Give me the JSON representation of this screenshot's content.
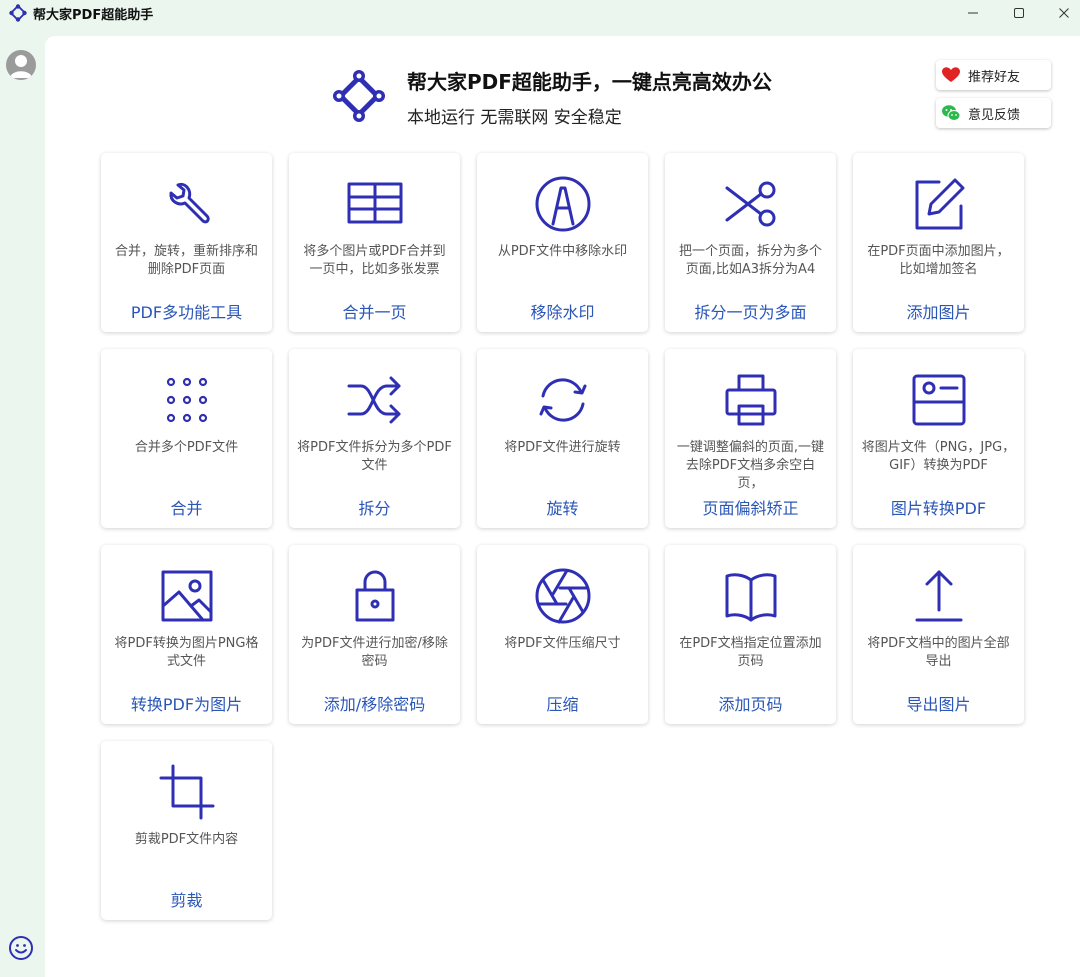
{
  "window": {
    "title": "帮大家PDF超能助手",
    "controls": [
      "minimize",
      "maximize",
      "close"
    ]
  },
  "header": {
    "title": "帮大家PDF超能助手，一键点亮高效办公",
    "subtitle": "本地运行 无需联网 安全稳定",
    "recommend_label": "推荐好友",
    "feedback_label": "意见反馈"
  },
  "colors": {
    "accent": "#2f2fb4",
    "label": "#2a56b8",
    "sidebar_bg": "#eaf6ee",
    "recommend": "#e02424",
    "feedback": "#2db84d"
  },
  "tools": [
    {
      "icon": "wrench-icon",
      "desc": "合并，旋转，重新排序和删除PDF页面",
      "label": "PDF多功能工具"
    },
    {
      "icon": "table-grid-icon",
      "desc": "将多个图片或PDF合并到一页中，比如多张发票",
      "label": "合并一页"
    },
    {
      "icon": "watermark-icon",
      "desc": "从PDF文件中移除水印",
      "label": "移除水印"
    },
    {
      "icon": "scissors-icon",
      "desc": "把一个页面，拆分为多个页面,比如A3拆分为A4",
      "label": "拆分一页为多面"
    },
    {
      "icon": "edit-icon",
      "desc": "在PDF页面中添加图片，比如增加签名",
      "label": "添加图片"
    },
    {
      "icon": "dots-grid-icon",
      "desc": "合并多个PDF文件",
      "label": "合并"
    },
    {
      "icon": "shuffle-icon",
      "desc": "将PDF文件拆分为多个PDF文件",
      "label": "拆分"
    },
    {
      "icon": "rotate-icon",
      "desc": "将PDF文件进行旋转",
      "label": "旋转"
    },
    {
      "icon": "printer-icon",
      "desc": "一键调整偏斜的页面,一键去除PDF文档多余空白页，",
      "label": "页面偏斜矫正"
    },
    {
      "icon": "id-card-icon",
      "desc": "将图片文件（PNG，JPG，GIF）转换为PDF",
      "label": "图片转换PDF"
    },
    {
      "icon": "image-icon",
      "desc": "将PDF转换为图片PNG格式文件",
      "label": "转换PDF为图片"
    },
    {
      "icon": "lock-icon",
      "desc": "为PDF文件进行加密/移除密码",
      "label": "添加/移除密码"
    },
    {
      "icon": "aperture-icon",
      "desc": "将PDF文件压缩尺寸",
      "label": "压缩"
    },
    {
      "icon": "book-icon",
      "desc": "在PDF文档指定位置添加页码",
      "label": "添加页码"
    },
    {
      "icon": "upload-icon",
      "desc": "将PDF文档中的图片全部导出",
      "label": "导出图片"
    },
    {
      "icon": "crop-icon",
      "desc": "剪裁PDF文件内容",
      "label": "剪裁"
    }
  ]
}
